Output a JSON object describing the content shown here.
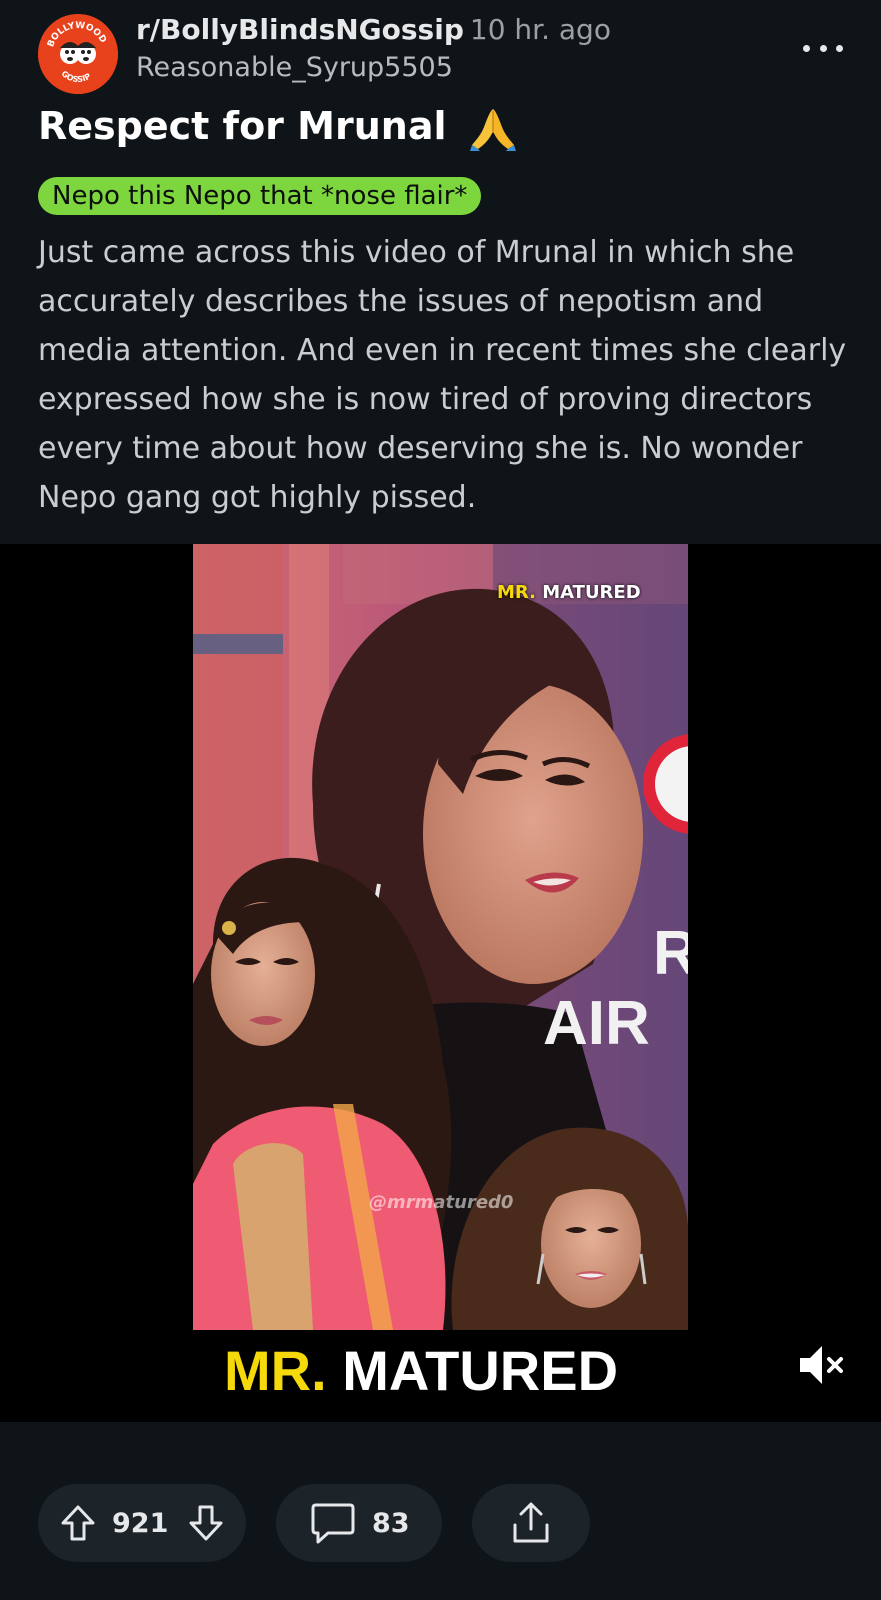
{
  "post": {
    "subreddit": "r/BollyBlindsNGossip",
    "time_ago": "10 hr. ago",
    "author": "Reasonable_Syrup5505",
    "title": "Respect for Mrunal",
    "title_emoji_icon": "folded-hands-icon",
    "flair": "Nepo this Nepo that *nose flair*",
    "flair_color": "#7ed63f",
    "body": "Just came across this video of Mrunal in which she accurately describes the issues of nepotism and media attention. And even in recent times she clearly expressed how she is now tired of proving directors every time about how deserving she is. No wonder Nepo gang got highly pissed."
  },
  "subreddit_icon": {
    "top_text": "BOLLYWOOD",
    "bottom_text": "GOSSIP",
    "color": "#e8421c"
  },
  "media": {
    "watermark_prefix": "MR.",
    "watermark_rest": " MATURED",
    "handle": "@mrmatured0",
    "overlay_text": "AIR",
    "overlay_text_2": "R",
    "caption_prefix": "MR.",
    "caption_rest": " MATURED",
    "accent_color": "#f5d90a",
    "mute_icon": "speaker-muted-icon"
  },
  "actions": {
    "upvotes": "921",
    "comments": "83",
    "upvote_icon": "arrow-up-icon",
    "downvote_icon": "arrow-down-icon",
    "comment_icon": "speech-bubble-icon",
    "share_icon": "share-icon",
    "more_icon": "more-dots-icon"
  }
}
